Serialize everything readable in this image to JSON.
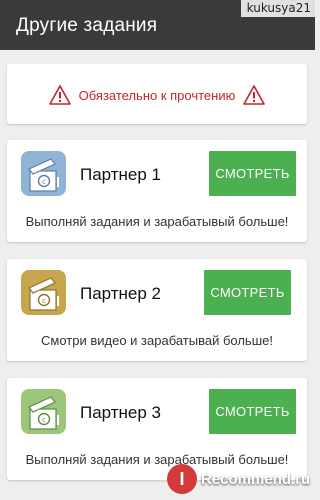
{
  "header": {
    "title": "Другие задания",
    "user_watermark": "kukusya21"
  },
  "notice": {
    "text": "Обязательно к прочтению",
    "icon": "warning-icon",
    "color": "#c0262d"
  },
  "partners": [
    {
      "name": "Партнер 1",
      "button": "СМОТРЕТЬ",
      "description": "Выполняй задания и зарабатывый больше!",
      "logo_color": "#8fb4d6",
      "icon": "partner-box-icon"
    },
    {
      "name": "Партнер 2",
      "button": "СМОТРЕТЬ",
      "description": "Смотри видео и зарабатывай больше!",
      "logo_color": "#c8a64e",
      "icon": "partner-box-icon"
    },
    {
      "name": "Партнер 3",
      "button": "СМОТРЕТЬ",
      "description": "Выполняй задания и зарабатывый больше!",
      "logo_color": "#9cc77a",
      "icon": "partner-box-icon"
    }
  ],
  "colors": {
    "header_bg": "#3a3a3c",
    "button_bg": "#4caf50",
    "background": "#eeeeee"
  },
  "watermark_site": {
    "badge": "I",
    "text": "Recommend.ru"
  }
}
